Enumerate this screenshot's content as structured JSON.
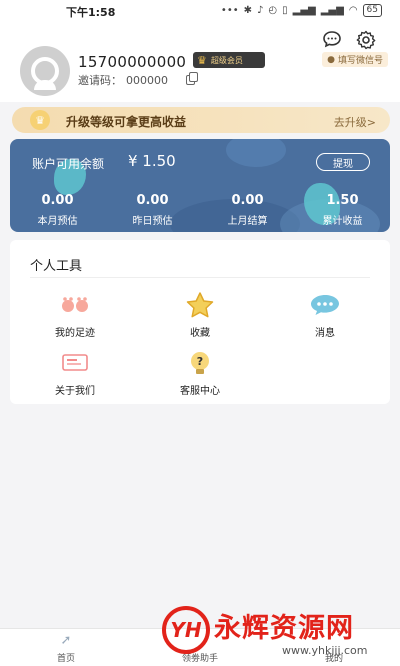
{
  "status": {
    "time": "下午1:58",
    "battery": "65"
  },
  "profile": {
    "phone": "15700000000",
    "vip_label": "超级会员",
    "invite_label": "邀请码：",
    "invite_code": "000000",
    "wechat_button": "填写微信号"
  },
  "banner": {
    "text": "升级等级可拿更高收益",
    "action": "去升级>"
  },
  "balance": {
    "label": "账户可用余额",
    "value": "¥ 1.50",
    "withdraw_label": "提现",
    "stats": [
      {
        "value": "0.00",
        "label": "本月预估"
      },
      {
        "value": "0.00",
        "label": "昨日预估"
      },
      {
        "value": "0.00",
        "label": "上月结算"
      },
      {
        "value": "1.50",
        "label": "累计收益"
      }
    ]
  },
  "tools": {
    "title": "个人工具",
    "items": [
      {
        "label": "我的足迹",
        "icon": "footprint-icon"
      },
      {
        "label": "收藏",
        "icon": "star-icon"
      },
      {
        "label": "消息",
        "icon": "message-icon"
      },
      {
        "label": "关于我们",
        "icon": "about-icon"
      },
      {
        "label": "客服中心",
        "icon": "help-bulb-icon"
      }
    ]
  },
  "nav": {
    "items": [
      {
        "label": "首页"
      },
      {
        "label": "领劵助手"
      },
      {
        "label": "我的"
      }
    ]
  },
  "watermark": {
    "logo": "YH",
    "brand": "永辉资源网",
    "url": "www.yhkjjj.com"
  },
  "colors": {
    "card": "#4a6f9e",
    "accent_teal": "#5ec6cf",
    "banner": "#f4dcb0",
    "watermark": "#e2231a"
  }
}
